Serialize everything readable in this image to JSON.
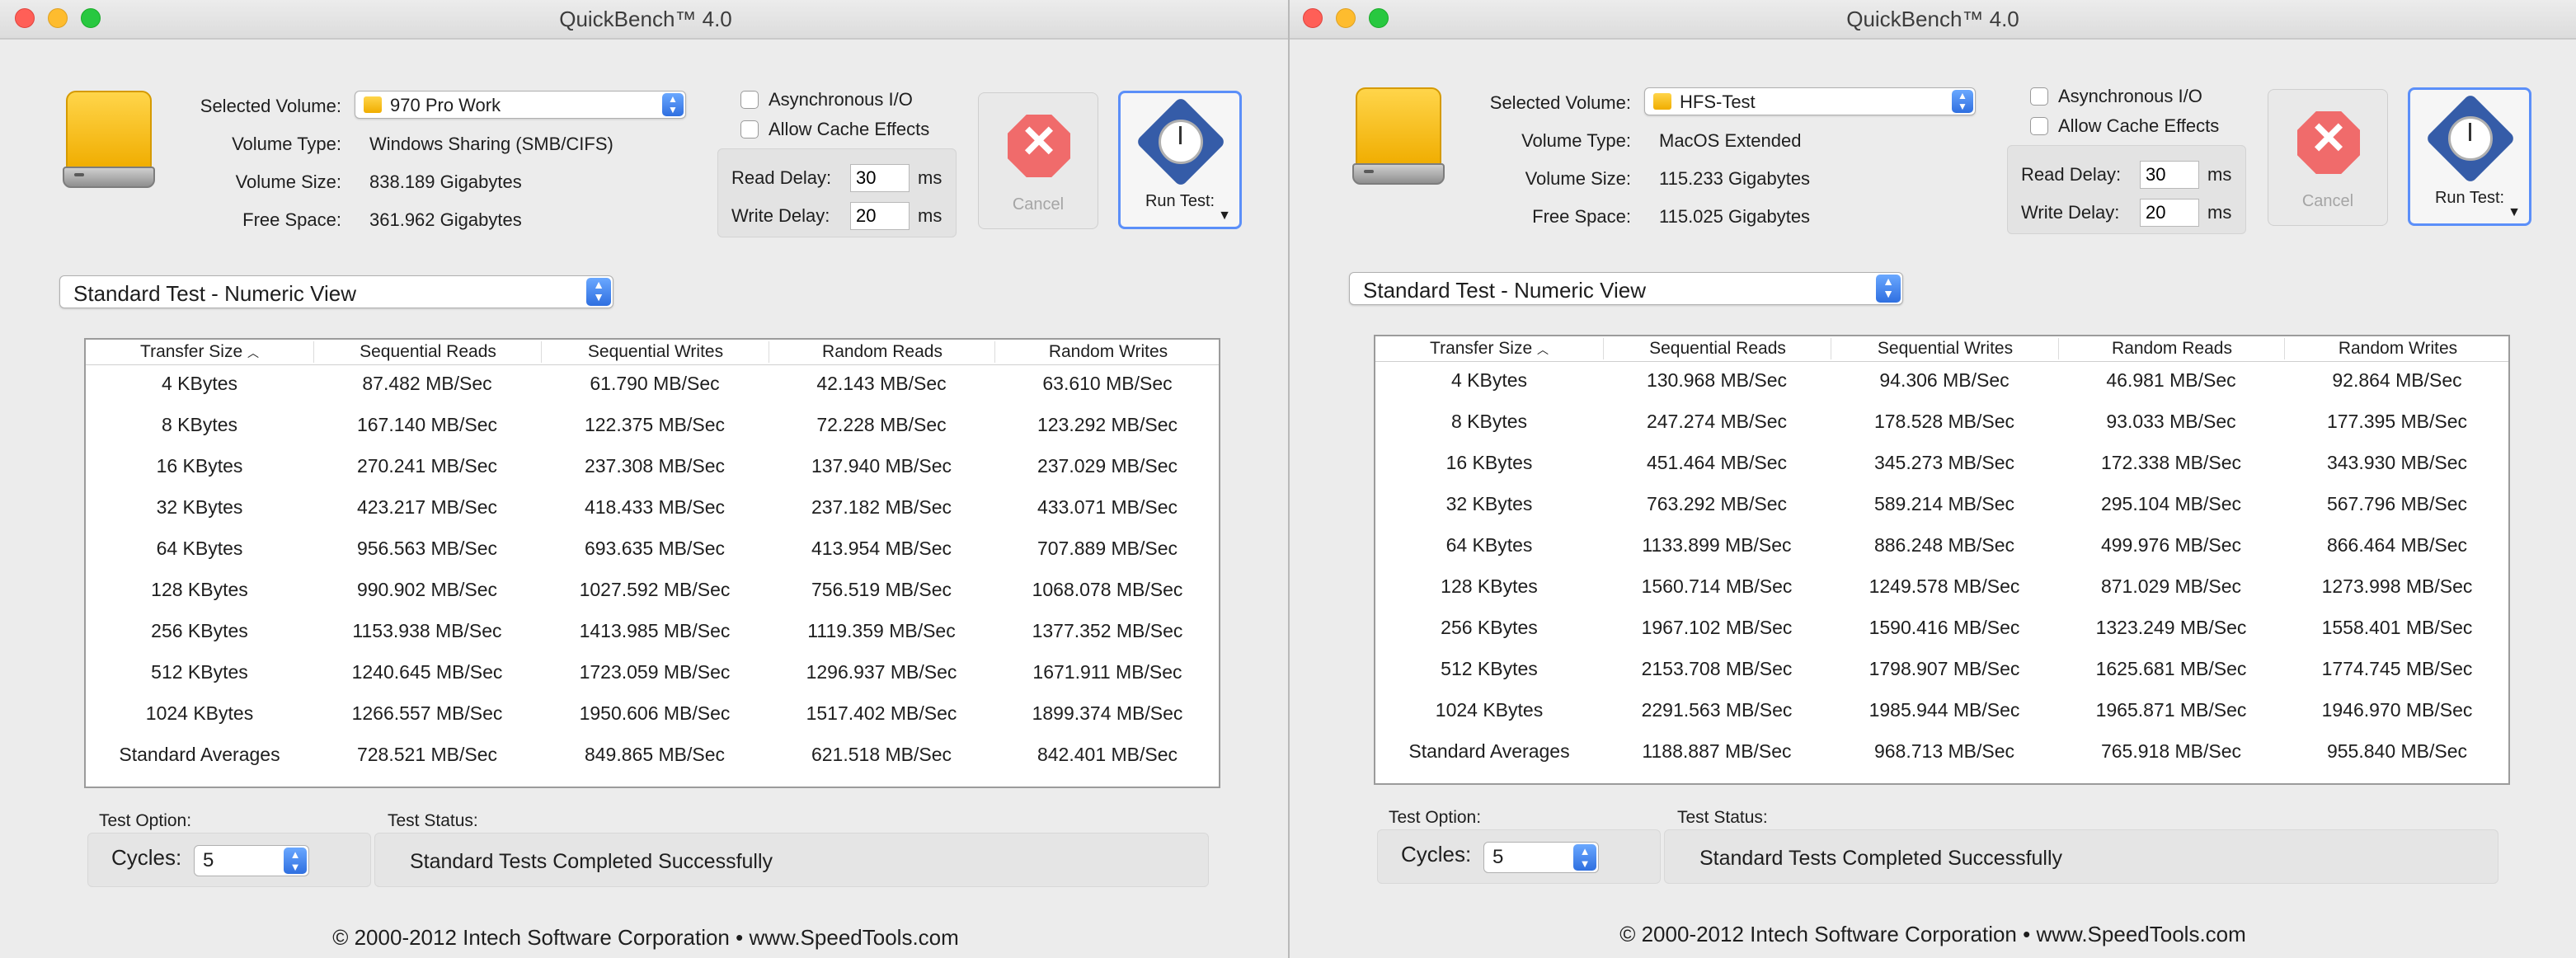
{
  "windows": [
    {
      "title": "QuickBench™ 4.0",
      "volume": {
        "selected_label": "Selected Volume:",
        "selected_value": "970 Pro Work",
        "type_label": "Volume Type:",
        "type_value": "Windows Sharing (SMB/CIFS)",
        "size_label": "Volume Size:",
        "size_value": "838.189 Gigabytes",
        "free_label": "Free Space:",
        "free_value": "361.962 Gigabytes"
      },
      "options": {
        "async_io": "Asynchronous I/O",
        "cache_effects": "Allow Cache Effects",
        "read_delay_label": "Read Delay:",
        "read_delay_value": "30",
        "write_delay_label": "Write Delay:",
        "write_delay_value": "20",
        "ms": "ms"
      },
      "buttons": {
        "cancel": "Cancel",
        "run": "Run Test:"
      },
      "view_selector": "Standard Test - Numeric View",
      "table": {
        "headers": [
          "Transfer Size",
          "Sequential Reads",
          "Sequential Writes",
          "Random Reads",
          "Random Writes"
        ],
        "rows": [
          [
            "4 KBytes",
            "87.482 MB/Sec",
            "61.790 MB/Sec",
            "42.143 MB/Sec",
            "63.610 MB/Sec"
          ],
          [
            "8 KBytes",
            "167.140 MB/Sec",
            "122.375 MB/Sec",
            "72.228 MB/Sec",
            "123.292 MB/Sec"
          ],
          [
            "16 KBytes",
            "270.241 MB/Sec",
            "237.308 MB/Sec",
            "137.940 MB/Sec",
            "237.029 MB/Sec"
          ],
          [
            "32 KBytes",
            "423.217 MB/Sec",
            "418.433 MB/Sec",
            "237.182 MB/Sec",
            "433.071 MB/Sec"
          ],
          [
            "64 KBytes",
            "956.563 MB/Sec",
            "693.635 MB/Sec",
            "413.954 MB/Sec",
            "707.889 MB/Sec"
          ],
          [
            "128 KBytes",
            "990.902 MB/Sec",
            "1027.592 MB/Sec",
            "756.519 MB/Sec",
            "1068.078 MB/Sec"
          ],
          [
            "256 KBytes",
            "1153.938 MB/Sec",
            "1413.985 MB/Sec",
            "1119.359 MB/Sec",
            "1377.352 MB/Sec"
          ],
          [
            "512 KBytes",
            "1240.645 MB/Sec",
            "1723.059 MB/Sec",
            "1296.937 MB/Sec",
            "1671.911 MB/Sec"
          ],
          [
            "1024 KBytes",
            "1266.557 MB/Sec",
            "1950.606 MB/Sec",
            "1517.402 MB/Sec",
            "1899.374 MB/Sec"
          ],
          [
            "Standard Averages",
            "728.521 MB/Sec",
            "849.865 MB/Sec",
            "621.518 MB/Sec",
            "842.401 MB/Sec"
          ]
        ]
      },
      "test_option_label": "Test Option:",
      "cycles_label": "Cycles:",
      "cycles_value": "5",
      "test_status_label": "Test Status:",
      "status_text": "Standard Tests Completed Successfully",
      "copyright": "© 2000-2012 Intech Software Corporation • www.SpeedTools.com"
    },
    {
      "title": "QuickBench™ 4.0",
      "volume": {
        "selected_label": "Selected Volume:",
        "selected_value": "HFS-Test",
        "type_label": "Volume Type:",
        "type_value": "MacOS Extended",
        "size_label": "Volume Size:",
        "size_value": "115.233 Gigabytes",
        "free_label": "Free Space:",
        "free_value": "115.025 Gigabytes"
      },
      "options": {
        "async_io": "Asynchronous I/O",
        "cache_effects": "Allow Cache Effects",
        "read_delay_label": "Read Delay:",
        "read_delay_value": "30",
        "write_delay_label": "Write Delay:",
        "write_delay_value": "20",
        "ms": "ms"
      },
      "buttons": {
        "cancel": "Cancel",
        "run": "Run Test:"
      },
      "view_selector": "Standard Test - Numeric View",
      "table": {
        "headers": [
          "Transfer Size",
          "Sequential Reads",
          "Sequential Writes",
          "Random Reads",
          "Random Writes"
        ],
        "rows": [
          [
            "4 KBytes",
            "130.968 MB/Sec",
            "94.306 MB/Sec",
            "46.981 MB/Sec",
            "92.864 MB/Sec"
          ],
          [
            "8 KBytes",
            "247.274 MB/Sec",
            "178.528 MB/Sec",
            "93.033 MB/Sec",
            "177.395 MB/Sec"
          ],
          [
            "16 KBytes",
            "451.464 MB/Sec",
            "345.273 MB/Sec",
            "172.338 MB/Sec",
            "343.930 MB/Sec"
          ],
          [
            "32 KBytes",
            "763.292 MB/Sec",
            "589.214 MB/Sec",
            "295.104 MB/Sec",
            "567.796 MB/Sec"
          ],
          [
            "64 KBytes",
            "1133.899 MB/Sec",
            "886.248 MB/Sec",
            "499.976 MB/Sec",
            "866.464 MB/Sec"
          ],
          [
            "128 KBytes",
            "1560.714 MB/Sec",
            "1249.578 MB/Sec",
            "871.029 MB/Sec",
            "1273.998 MB/Sec"
          ],
          [
            "256 KBytes",
            "1967.102 MB/Sec",
            "1590.416 MB/Sec",
            "1323.249 MB/Sec",
            "1558.401 MB/Sec"
          ],
          [
            "512 KBytes",
            "2153.708 MB/Sec",
            "1798.907 MB/Sec",
            "1625.681 MB/Sec",
            "1774.745 MB/Sec"
          ],
          [
            "1024 KBytes",
            "2291.563 MB/Sec",
            "1985.944 MB/Sec",
            "1965.871 MB/Sec",
            "1946.970 MB/Sec"
          ],
          [
            "Standard Averages",
            "1188.887 MB/Sec",
            "968.713 MB/Sec",
            "765.918 MB/Sec",
            "955.840 MB/Sec"
          ]
        ]
      },
      "test_option_label": "Test Option:",
      "cycles_label": "Cycles:",
      "cycles_value": "5",
      "test_status_label": "Test Status:",
      "status_text": "Standard Tests Completed Successfully",
      "copyright": "© 2000-2012 Intech Software Corporation • www.SpeedTools.com"
    }
  ]
}
